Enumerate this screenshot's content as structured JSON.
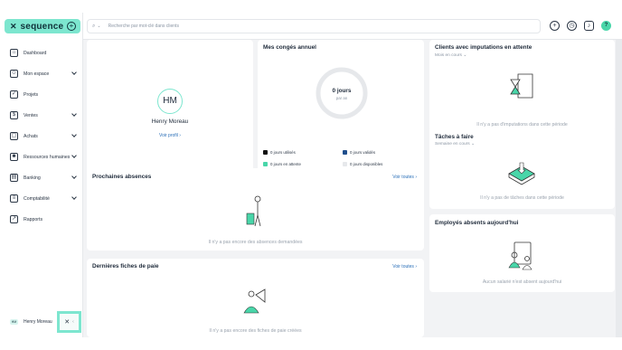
{
  "sidebar": {
    "brand": "sequence",
    "items": [
      {
        "label": "Dashboard",
        "icon": "home-icon",
        "glyph": "⌂",
        "expandable": false
      },
      {
        "label": "Mon espace",
        "icon": "user-icon",
        "glyph": "☺",
        "expandable": true
      },
      {
        "label": "Projets",
        "icon": "check-icon",
        "glyph": "✓",
        "expandable": false
      },
      {
        "label": "Ventes",
        "icon": "sales-icon",
        "glyph": "$",
        "expandable": true
      },
      {
        "label": "Achats",
        "icon": "bag-icon",
        "glyph": "▢",
        "expandable": true
      },
      {
        "label": "Ressources humaines",
        "icon": "people-icon",
        "glyph": "☻",
        "expandable": true
      },
      {
        "label": "Banking",
        "icon": "bank-icon",
        "glyph": "▤",
        "expandable": true
      },
      {
        "label": "Comptabilité",
        "icon": "ledger-icon",
        "glyph": "≡",
        "expandable": true
      },
      {
        "label": "Rapports",
        "icon": "chart-icon",
        "glyph": "↗",
        "expandable": false
      }
    ],
    "user": {
      "initials": "HM",
      "name": "Henry Moreau"
    }
  },
  "topbar": {
    "search_placeholder": "Recherche par mot-clé dans clients"
  },
  "profile": {
    "initials": "HM",
    "name": "Henry Moreau",
    "link": "Voir profil"
  },
  "conges": {
    "title": "Mes congés annuel",
    "total": "0 jours",
    "per": "par an",
    "legend": [
      {
        "label": "0 jours utilisés",
        "color": "#111111"
      },
      {
        "label": "0 jours validés",
        "color": "#1f4e8c"
      },
      {
        "label": "0 jours en attente",
        "color": "#49d6a9"
      },
      {
        "label": "0 jours disponibles",
        "color": "#e6e8eb"
      }
    ]
  },
  "absences": {
    "title": "Prochaines absences",
    "link": "Voir toutes",
    "empty": "Il n'y a pas encore des absences demandées"
  },
  "fiches": {
    "title": "Dernières fiches de paie",
    "link": "Voir toutes",
    "empty": "Il n'y a pas encore des fiches de paie créées"
  },
  "imputations": {
    "title": "Clients avec imputations en attente",
    "filter": "Mois en cours",
    "empty": "Il n'y a pas d'imputations dans cette période"
  },
  "taches": {
    "title": "Tâches à faire",
    "filter": "Semaine en cours",
    "empty": "Il n'y a pas de tâches dans cette période"
  },
  "employes": {
    "title": "Employés absents aujourd'hui",
    "empty": "Aucun salarié n'est absent aujourd'hui"
  }
}
